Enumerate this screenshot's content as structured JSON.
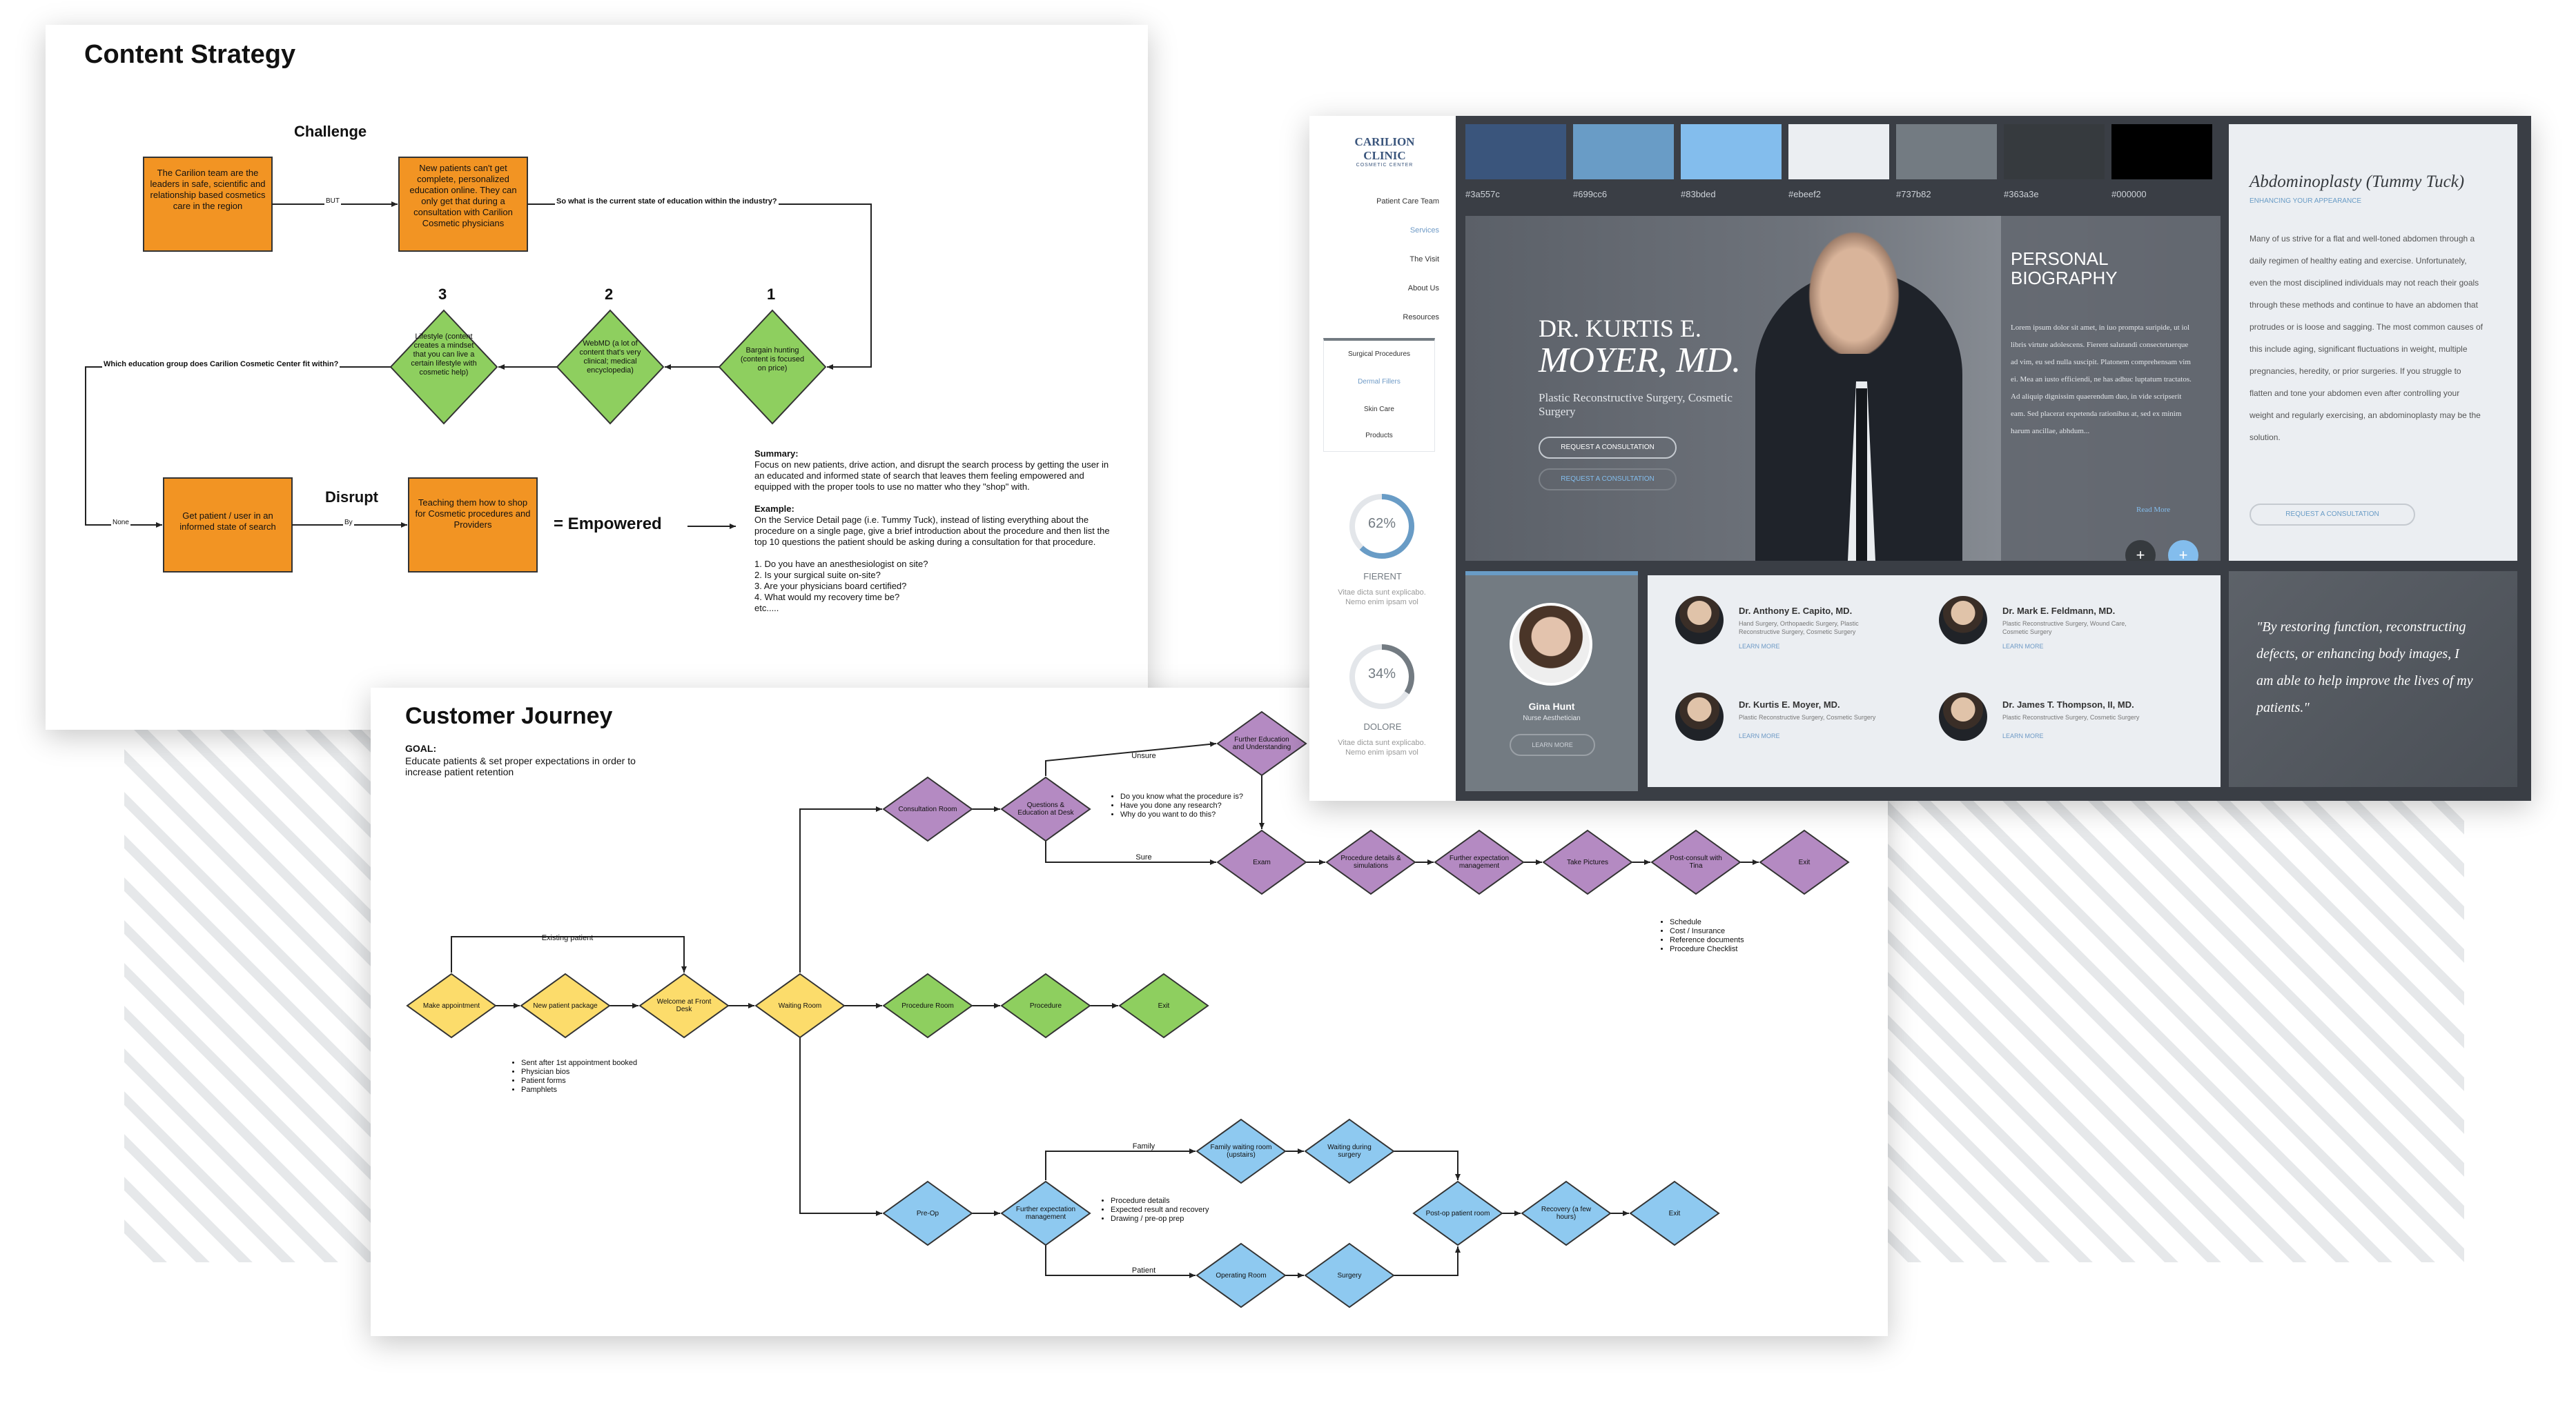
{
  "content_strategy": {
    "title": "Content Strategy",
    "challenge_label": "Challenge",
    "disrupt_label": "Disrupt",
    "box1": "The Carilion team are the leaders in safe, scientific and relationship based cosmetics care in the region",
    "but_label": "BUT",
    "box2": "New patients can't get complete, personalized education online. They can only get that during a consultation with Carilion Cosmetic physicians",
    "question1": "So what is the current state of education within the industry?",
    "d1_num": "1",
    "d1_text": "Bargain hunting (content is focused on price)",
    "d2_num": "2",
    "d2_text": "WebMD (a lot of content that's very clinical; medical encyclopedia)",
    "d3_num": "3",
    "d3_text": "Lifestyle (content creates a mindset that you can live a certain lifestyle with cosmetic help)",
    "question2": "Which education group does Carilion Cosmetic Center fit within?",
    "none_label": "None",
    "box3": "Get patient / user in an informed state of search",
    "by_label": "By",
    "box4": "Teaching them how to shop for Cosmetic procedures and Providers",
    "empowered": "= Empowered",
    "summary_title": "Summary:",
    "summary_text": "Focus on new patients, drive action, and disrupt the search process by getting the user in an educated and informed state of search that leaves them feeling empowered and equipped with the proper tools to use no matter who they \"shop\" with.",
    "example_title": "Example:",
    "example_text": "On the Service Detail page (i.e. Tummy Tuck), instead of listing everything about the procedure on a single page, give a brief introduction about the procedure and then list the top 10 questions the patient should be asking during a consultation for that procedure.",
    "questions": [
      "1. Do you have an anesthesiologist on site?",
      "2. Is your surgical suite on-site?",
      "3. Are your physicians board certified?",
      "4. What would my recovery time be?",
      "etc....."
    ]
  },
  "customer_journey": {
    "title": "Customer Journey",
    "goal_label": "GOAL:",
    "goal_text": "Educate patients & set proper expectations in order to increase patient retention",
    "nodes": {
      "make_appt": "Make appointment",
      "new_package": "New patient package",
      "welcome": "Welcome at Front Desk",
      "waiting": "Waiting Room",
      "consult_room": "Consultation Room",
      "questions": "Questions & Education at Desk",
      "further_edu": "Further Education and Understanding",
      "exam": "Exam",
      "proc_details": "Procedure details & simulations",
      "further_exp1": "Further expectation management",
      "pictures": "Take Pictures",
      "postconsult": "Post-consult with Tina",
      "exit1": "Exit",
      "proc_room": "Procedure Room",
      "procedure": "Procedure",
      "exit2": "Exit",
      "preop": "Pre-Op",
      "further_exp2": "Further expectation management",
      "family_room": "Family waiting room (upstairs)",
      "wait_surgery": "Waiting during surgery",
      "op_room": "Operating Room",
      "surgery": "Surgery",
      "postop": "Post-op patient room",
      "recovery": "Recovery (a few hours)",
      "exit3": "Exit"
    },
    "labels": {
      "existing": "Existing patient",
      "unsure": "Unsure",
      "sure": "Sure",
      "family": "Family",
      "patient": "Patient"
    },
    "questions_list": [
      "Do you know what the procedure is?",
      "Have you done any research?",
      "Why do you want to do this?"
    ],
    "package_list": [
      "Sent after 1st appointment booked",
      "Physician bios",
      "Patient forms",
      "Pamphlets"
    ],
    "postconsult_list": [
      "Schedule",
      "Cost / Insurance",
      "Reference documents",
      "Procedure Checklist"
    ],
    "preop_list": [
      "Procedure details",
      "Expected result and recovery",
      "Drawing / pre-op prep"
    ]
  },
  "mockup": {
    "logo_main": "CARILION CLINIC",
    "logo_sub": "COSMETIC CENTER",
    "nav": [
      "Patient Care Team",
      "Services",
      "The Visit",
      "About Us",
      "Resources"
    ],
    "subnav": [
      "Surgical Procedures",
      "Dermal Fillers",
      "Skin Care",
      "Products"
    ],
    "stat1_pct": "62%",
    "stat1_label": "FIERENT",
    "stat1_text": "Vitae dicta sunt explicabo. Nemo enim ipsam vol",
    "stat2_pct": "34%",
    "stat2_label": "DOLORE",
    "stat2_text": "Vitae dicta sunt explicabo. Nemo enim ipsam vol",
    "stat1_value": 0.62,
    "stat2_value": 0.34,
    "swatches": [
      {
        "hex": "#3a557c",
        "label": "#3a557c"
      },
      {
        "hex": "#699cc6",
        "label": "#699cc6"
      },
      {
        "hex": "#83bded",
        "label": "#83bded"
      },
      {
        "hex": "#ebeef2",
        "label": "#ebeef2"
      },
      {
        "hex": "#737b82",
        "label": "#737b82"
      },
      {
        "hex": "#363a3e",
        "label": "#363a3e"
      },
      {
        "hex": "#000000",
        "label": "#000000"
      }
    ],
    "hero_name_line1": "DR. KURTIS E.",
    "hero_name_line2": "MOYER, MD.",
    "hero_specialty": "Plastic Reconstructive Surgery, Cosmetic Surgery",
    "btn_consult": "REQUEST A CONSULTATION",
    "btn_consult2": "REQUEST A CONSULTATION",
    "bio_title": "PERSONAL BIOGRAPHY",
    "bio_text": "Lorem ipsum dolor sit amet, in iuo prompta suripide, ut iol libris virtute adolescens. Fierent salutandi consectetuerque ad vim, eu sed nulla suscipit. Platonem comprehensam vim ei. Mea an iusto efficiendi, ne has adhuc luptatum tractatos. Ad aliquip dignissim quaerendum duo, in vide scripserit eam. Sed placerat expetenda rationibus at, sed ex minim harum ancillae, abhdum...",
    "read_more": "Read More",
    "sidebar_title": "Abdominoplasty (Tummy Tuck)",
    "sidebar_sub": "ENHANCING YOUR APPEARANCE",
    "sidebar_text": "Many of us strive for a flat and well-toned abdomen through a daily regimen of healthy eating and exercise. Unfortunately, even the most disciplined individuals may not reach their goals through these methods and continue to have an abdomen that protrudes or is loose and sagging. The most common causes of this include aging, significant fluctuations in weight, multiple pregnancies, heredity, or prior surgeries. If you struggle to flatten and tone your abdomen even after controlling your weight and regularly exercising, an abdominoplasty may be the solution.",
    "sidebar_btn": "REQUEST A CONSULTATION",
    "quote": "\"By restoring function, reconstructing defects, or enhancing body images, I am able to help improve the lives of my patients.\"",
    "featured_name": "Gina Hunt",
    "featured_role": "Nurse Aesthetician",
    "featured_btn": "LEARN MORE",
    "doctors": [
      {
        "name": "Dr. Anthony E. Capito, MD.",
        "spec": "Hand Surgery, Orthopaedic Surgery, Plastic Reconstructive Surgery, Cosmetic Surgery",
        "link": "LEARN MORE"
      },
      {
        "name": "Dr. Mark E. Feldmann, MD.",
        "spec": "Plastic Reconstructive Surgery, Wound Care, Cosmetic Surgery",
        "link": "LEARN MORE"
      },
      {
        "name": "Dr. Kurtis E. Moyer, MD.",
        "spec": "Plastic Reconstructive Surgery, Cosmetic Surgery",
        "link": "LEARN MORE"
      },
      {
        "name": "Dr. James T. Thompson, II, MD.",
        "spec": "Plastic Reconstructive Surgery, Cosmetic Surgery",
        "link": "LEARN MORE"
      }
    ]
  }
}
